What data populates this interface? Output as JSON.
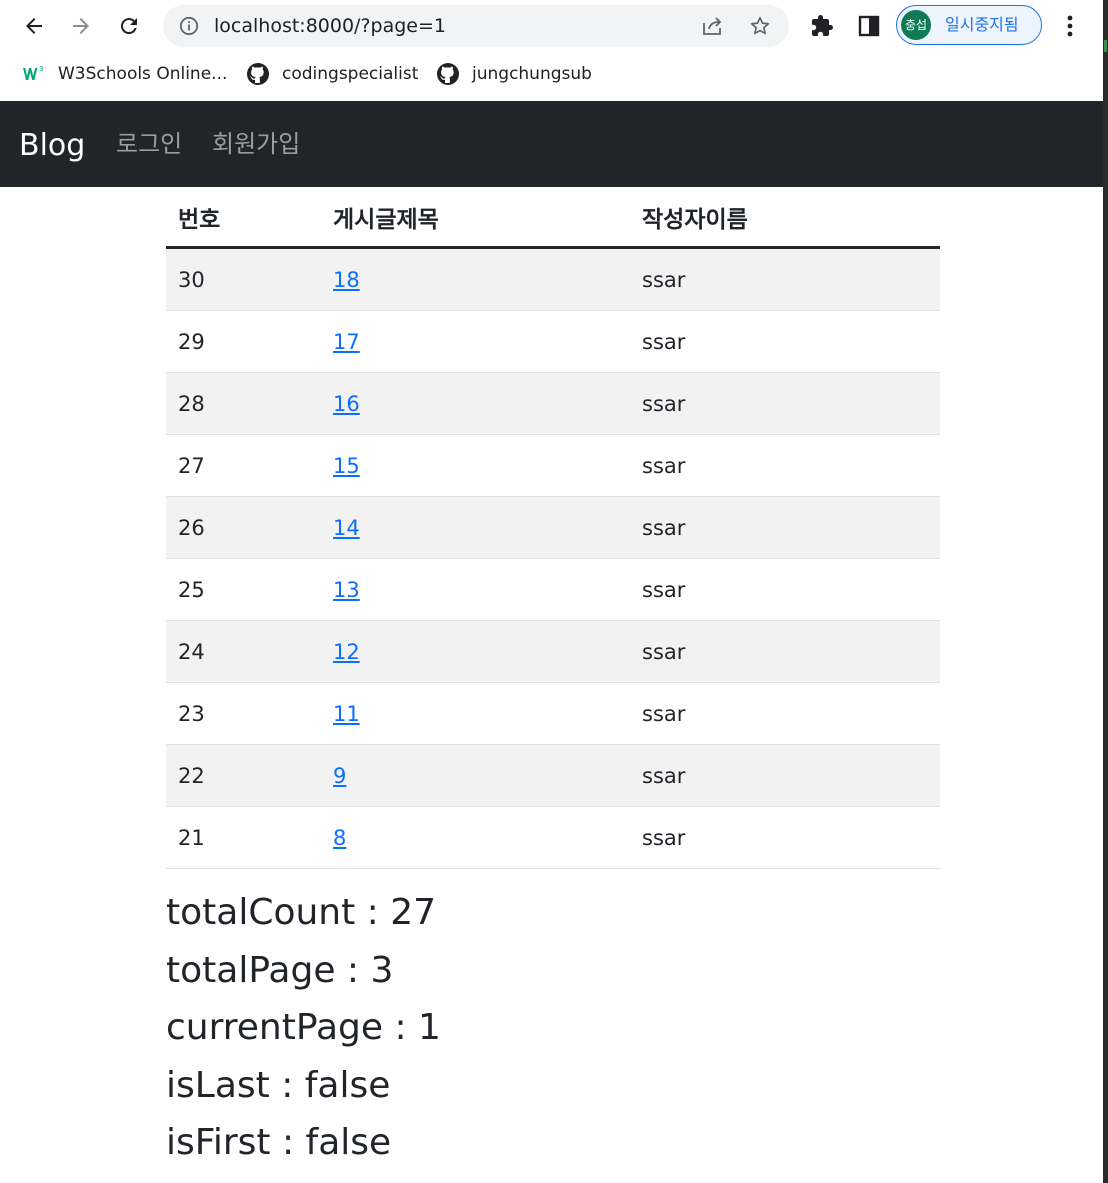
{
  "browser": {
    "url": "localhost:8000/?page=1",
    "profile_initials": "충섭",
    "profile_status": "일시중지됨",
    "bookmarks": [
      {
        "label": "W3Schools Online...",
        "icon": "w3schools-icon"
      },
      {
        "label": "codingspecialist",
        "icon": "github-icon"
      },
      {
        "label": "jungchungsub",
        "icon": "github-icon"
      }
    ]
  },
  "navbar": {
    "brand": "Blog",
    "links": [
      "로그인",
      "회원가입"
    ]
  },
  "table": {
    "headers": [
      "번호",
      "게시글제목",
      "작성자이름"
    ],
    "rows": [
      {
        "id": "30",
        "title": "18",
        "author": "ssar"
      },
      {
        "id": "29",
        "title": "17",
        "author": "ssar"
      },
      {
        "id": "28",
        "title": "16",
        "author": "ssar"
      },
      {
        "id": "27",
        "title": "15",
        "author": "ssar"
      },
      {
        "id": "26",
        "title": "14",
        "author": "ssar"
      },
      {
        "id": "25",
        "title": "13",
        "author": "ssar"
      },
      {
        "id": "24",
        "title": "12",
        "author": "ssar"
      },
      {
        "id": "23",
        "title": "11",
        "author": "ssar"
      },
      {
        "id": "22",
        "title": "9",
        "author": "ssar"
      },
      {
        "id": "21",
        "title": "8",
        "author": "ssar"
      }
    ]
  },
  "paging": {
    "lines": [
      "totalCount : 27",
      "totalPage : 3",
      "currentPage : 1",
      "isLast : false",
      "isFirst : false"
    ]
  },
  "colors": {
    "navbar_bg": "#212529",
    "link": "#0d6efd",
    "profile_accent": "#1a73e8",
    "avatar_bg": "#0f7a55"
  }
}
